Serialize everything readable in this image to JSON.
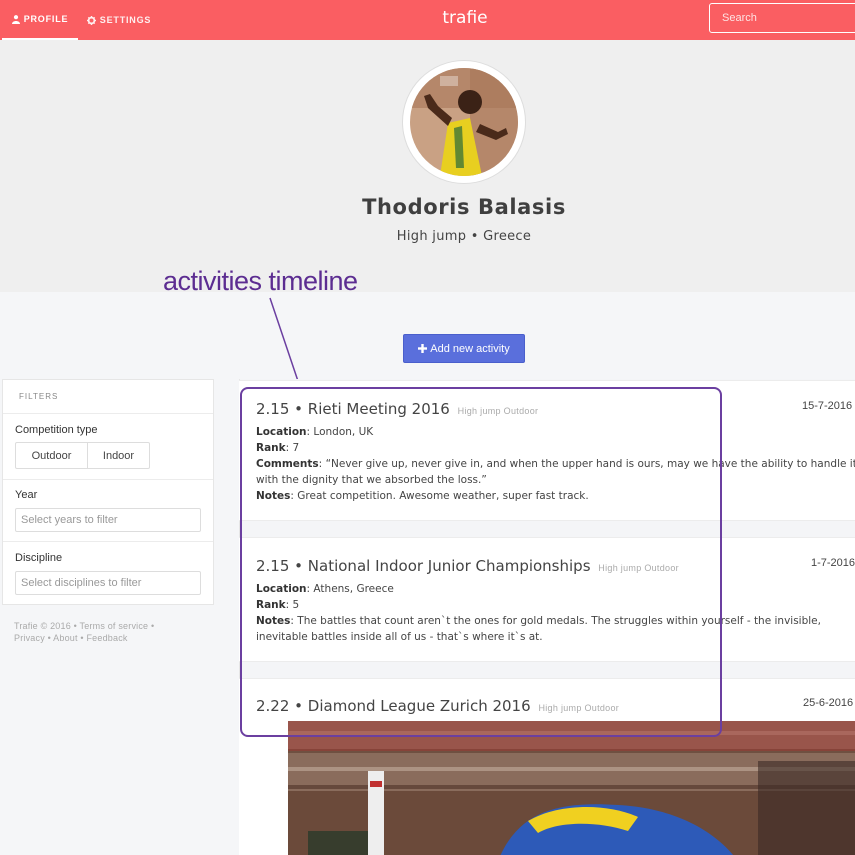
{
  "navbar": {
    "tabs": [
      {
        "label": "PROFILE",
        "icon": "user-icon"
      },
      {
        "label": "SETTINGS",
        "icon": "gear-icon"
      }
    ],
    "brand": "trafie",
    "search_placeholder": "Search"
  },
  "profile": {
    "name": "Thodoris Balasis",
    "subtitle": "High jump • Greece",
    "avatar_icon": "athlete-photo"
  },
  "annotation": "activities timeline",
  "add_activity_label": "Add new activity",
  "filters": {
    "title": "FILTERS",
    "competition_type": {
      "label": "Competition type",
      "options": [
        "Outdoor",
        "Indoor"
      ]
    },
    "year": {
      "label": "Year",
      "placeholder": "Select years to filter"
    },
    "discipline": {
      "label": "Discipline",
      "placeholder": "Select disciplines to filter"
    }
  },
  "footer": {
    "copyright": "Trafie © 2016",
    "links": [
      "Terms of service",
      "Privacy",
      "About",
      "Feedback"
    ]
  },
  "activities": [
    {
      "performance": "2.15",
      "competition": "Rieti Meeting 2016",
      "discipline_tag": "High jump",
      "type_tag": "Outdoor",
      "date": "15-7-2016",
      "location": "London, UK",
      "rank": "7",
      "comments": "“Never give up, never give in, and when the upper hand is ours, may we have the ability to handle it with the dignity that we absorbed the loss.”",
      "notes": "Great competition. Awesome weather, super fast track."
    },
    {
      "performance": "2.15",
      "competition": "National Indoor Junior Championships",
      "discipline_tag": "High jump",
      "type_tag": "Outdoor",
      "date": "1-7-2016",
      "location": "Athens, Greece",
      "rank": "5",
      "notes": "The battles that count aren`t the ones for gold medals. The struggles within yourself - the invisible, inevitable battles inside all of us - that`s where it`s at."
    },
    {
      "performance": "2.22",
      "competition": "Diamond League Zurich 2016",
      "discipline_tag": "High jump",
      "type_tag": "Outdoor",
      "date": "25-6-2016"
    }
  ],
  "labels": {
    "location": "Location",
    "rank": "Rank",
    "comments": "Comments",
    "notes": "Notes",
    "separator": " • "
  },
  "colors": {
    "navbar": "#fa5e62",
    "primary_button": "#5a6fdc",
    "annotation": "#5c2d91"
  }
}
